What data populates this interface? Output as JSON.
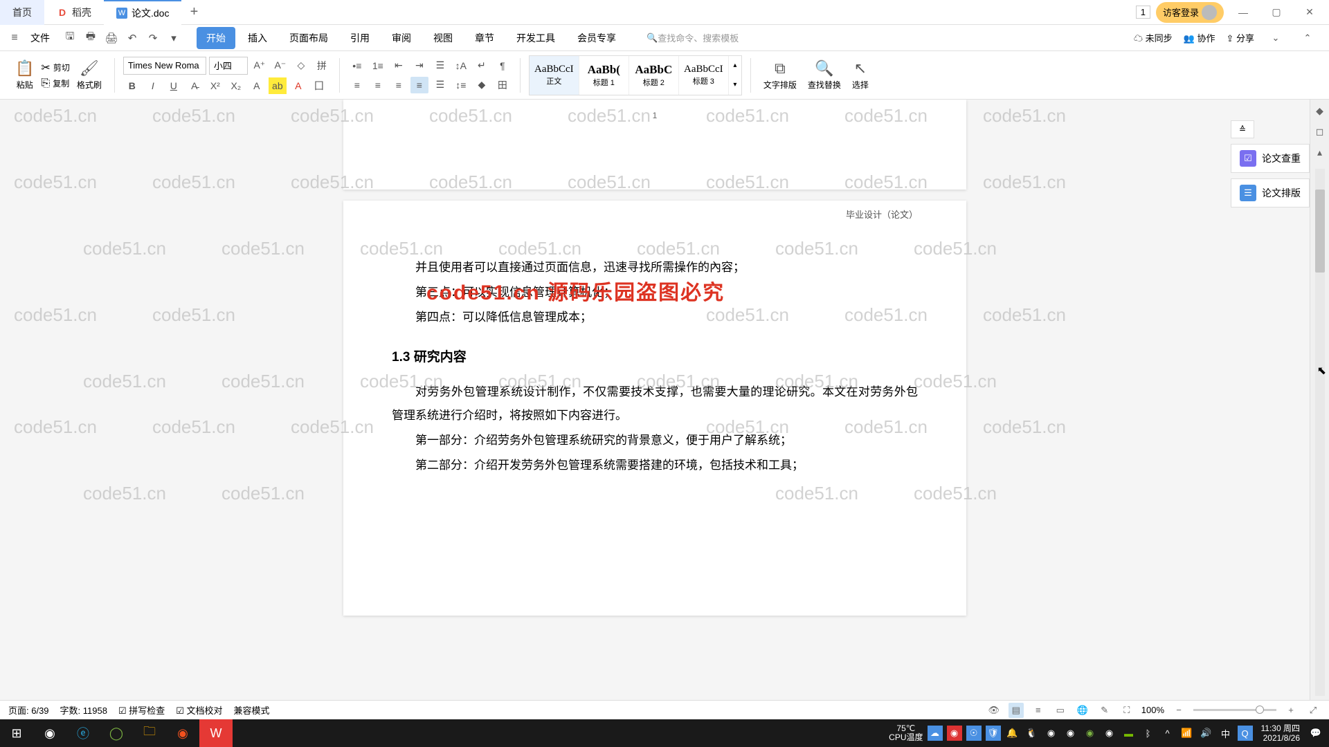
{
  "tabs": {
    "home": "首页",
    "docer": "稻壳",
    "doc": "论文.doc"
  },
  "titlebar": {
    "badge": "1",
    "login": "访客登录"
  },
  "menu": {
    "file": "文件",
    "tabs": [
      "开始",
      "插入",
      "页面布局",
      "引用",
      "审阅",
      "视图",
      "章节",
      "开发工具",
      "会员专享"
    ],
    "search_ph": "查找命令、搜索模板",
    "unsync": "未同步",
    "collab": "协作",
    "share": "分享"
  },
  "ribbon": {
    "paste": "粘贴",
    "cut": "剪切",
    "copy": "复制",
    "formatpaint": "格式刷",
    "font_name": "Times New Roma",
    "font_size": "小四",
    "styles": [
      {
        "preview": "AaBbCcI",
        "label": "正文"
      },
      {
        "preview": "AaBb(",
        "label": "标题 1"
      },
      {
        "preview": "AaBbC",
        "label": "标题 2"
      },
      {
        "preview": "AaBbCcI",
        "label": "标题 3"
      }
    ],
    "text_layout": "文字排版",
    "find": "查找替换",
    "select": "选择"
  },
  "sidepanel": {
    "dup_check": "论文查重",
    "format": "论文排版"
  },
  "doc": {
    "page1_num": "1",
    "header": "毕业设计（论文）",
    "red_overlay": "code51.cn 源码乐园盗图必究",
    "line_top": "并且使用者可以直接通过页面信息，迅速寻找所需操作的內容；",
    "p3": "第三点：可以实现信息管理计算机化；",
    "p4": "第四点：可以降低信息管理成本；",
    "h13": "1.3  研究内容",
    "b1": "对劳务外包管理系统设计制作，不仅需要技术支撑，也需要大量的理论研究。本文在对劳务外包管理系统进行介绍时，将按照如下内容进行。",
    "b2": "第一部分：介绍劳务外包管理系统研究的背景意义，便于用户了解系统；",
    "b3": "第二部分：介绍开发劳务外包管理系统需要搭建的环境，包括技术和工具；"
  },
  "status": {
    "page": "页面: 6/39",
    "words": "字数: 11958",
    "spell": "拼写检查",
    "proof": "文档校对",
    "compat": "兼容模式",
    "zoom": "100%"
  },
  "tray": {
    "cpu_lbl": "CPU温度",
    "cpu_temp": "75℃",
    "time": "11:30 周四",
    "date": "2021/8/26"
  },
  "watermark": "code51.cn"
}
